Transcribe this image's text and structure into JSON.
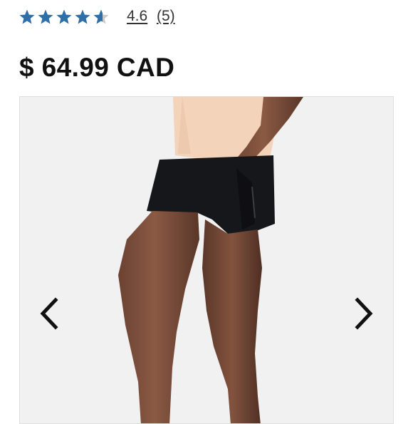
{
  "rating": {
    "stars_value": 4.6,
    "stars_max": 5,
    "star_color": "#2e6fa7",
    "star_empty_color": "#c9c9c9",
    "value_label": "4.6",
    "count_label": "(5)"
  },
  "price": {
    "label": "$ 64.99 CAD"
  },
  "gallery": {
    "product_image": "woman-wearing-black-shorts",
    "prev_icon": "chevron-left-icon",
    "next_icon": "chevron-right-icon"
  }
}
